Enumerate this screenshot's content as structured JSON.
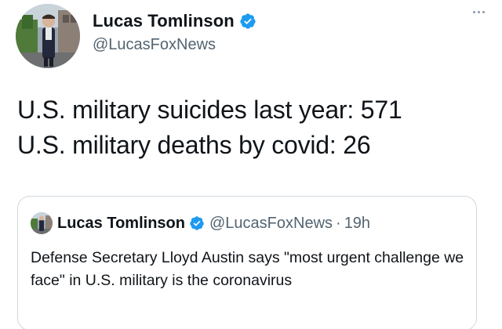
{
  "tweet": {
    "author": {
      "name": "Lucas Tomlinson",
      "handle": "@LucasFoxNews",
      "verified": true
    },
    "more_icon": "more-horizontal-icon",
    "lines": [
      "U.S. military suicides last year: 571",
      "U.S. military deaths by covid: 26"
    ]
  },
  "quoted_tweet": {
    "author": {
      "name": "Lucas Tomlinson",
      "handle": "@LucasFoxNews",
      "verified": true
    },
    "separator": "·",
    "time": "19h",
    "text": "Defense Secretary Lloyd Austin says \"most urgent challenge we face\" in U.S. military is the coronavirus"
  },
  "colors": {
    "verified_blue": "#1d9bf0",
    "text_primary": "#0f1419",
    "text_secondary": "#536471",
    "border": "#cfd9de"
  }
}
